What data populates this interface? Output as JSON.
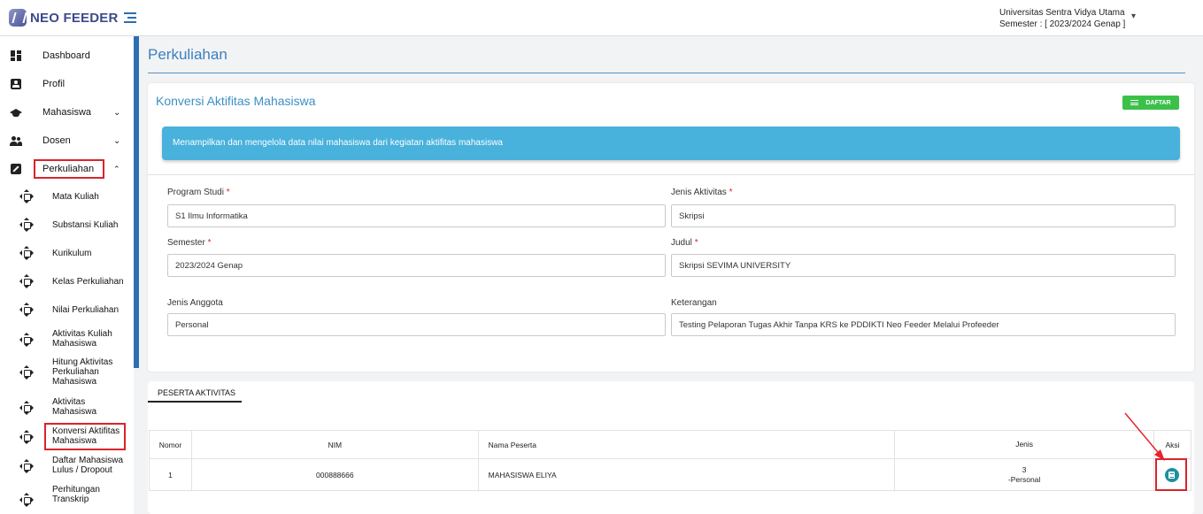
{
  "header": {
    "app_name": "NEO FEEDER",
    "university": "Universitas Sentra Vidya Utama",
    "semester": "Semester : [ 2023/2024 Genap ]"
  },
  "sidebar": {
    "main": [
      {
        "label": "Dashboard",
        "icon": "dashboard-icon"
      },
      {
        "label": "Profil",
        "icon": "profile-icon"
      },
      {
        "label": "Mahasiswa",
        "icon": "graduation-cap-icon",
        "expandable": true
      },
      {
        "label": "Dosen",
        "icon": "people-icon",
        "expandable": true
      },
      {
        "label": "Perkuliahan",
        "icon": "edit-square-icon",
        "expandable": true,
        "expanded": true,
        "highlighted": true
      }
    ],
    "sub": [
      {
        "label": "Mata Kuliah"
      },
      {
        "label": "Substansi Kuliah"
      },
      {
        "label": "Kurikulum"
      },
      {
        "label": "Kelas Perkuliahan"
      },
      {
        "label": "Nilai Perkuliahan"
      },
      {
        "label": "Aktivitas Kuliah Mahasiswa"
      },
      {
        "label": "Hitung Aktivitas Perkuliahan Mahasiswa"
      },
      {
        "label": "Aktivitas Mahasiswa"
      },
      {
        "label": "Konversi Aktifitas Mahasiswa",
        "highlighted": true
      },
      {
        "label": "Daftar Mahasiswa Lulus / Dropout"
      },
      {
        "label": "Perhitungan Transkrip"
      }
    ]
  },
  "page": {
    "title": "Perkuliahan",
    "card_title": "Konversi Aktifitas Mahasiswa",
    "daftar_label": "DAFTAR",
    "banner": "Menampilkan dan mengelola data nilai mahasiswa dari kegiatan aktifitas mahasiswa"
  },
  "form": {
    "program_studi": {
      "label": "Program Studi",
      "value": "S1 Ilmu Informatika"
    },
    "jenis_aktivitas": {
      "label": "Jenis Aktivitas",
      "value": "Skripsi"
    },
    "semester": {
      "label": "Semester",
      "value": "2023/2024 Genap"
    },
    "judul": {
      "label": "Judul",
      "value": "Skripsi SEVIMA UNIVERSITY"
    },
    "jenis_anggota": {
      "label": "Jenis Anggota",
      "value": "Personal"
    },
    "keterangan": {
      "label": "Keterangan",
      "value": "Testing Pelaporan Tugas Akhir Tanpa KRS ke PDDIKTI Neo Feeder Melalui Profeeder"
    },
    "required_mark": "*"
  },
  "peserta": {
    "tab_label": "PESERTA AKTIVITAS",
    "columns": [
      "Nomor",
      "NIM",
      "Nama Peserta",
      "Jenis",
      "Aksi"
    ],
    "rows": [
      {
        "nomor": "1",
        "nim": "000888666",
        "nama": "MAHASISWA ELIYA",
        "jenis_code": "3",
        "jenis_name": "-Personal",
        "aksi_icon": "detail-icon"
      }
    ]
  },
  "colors": {
    "accent_blue": "#3c80bd",
    "banner_blue": "#48b1dc",
    "button_green": "#3bc14a",
    "highlight_red": "#d9242b",
    "action_teal": "#1e8fa0"
  }
}
